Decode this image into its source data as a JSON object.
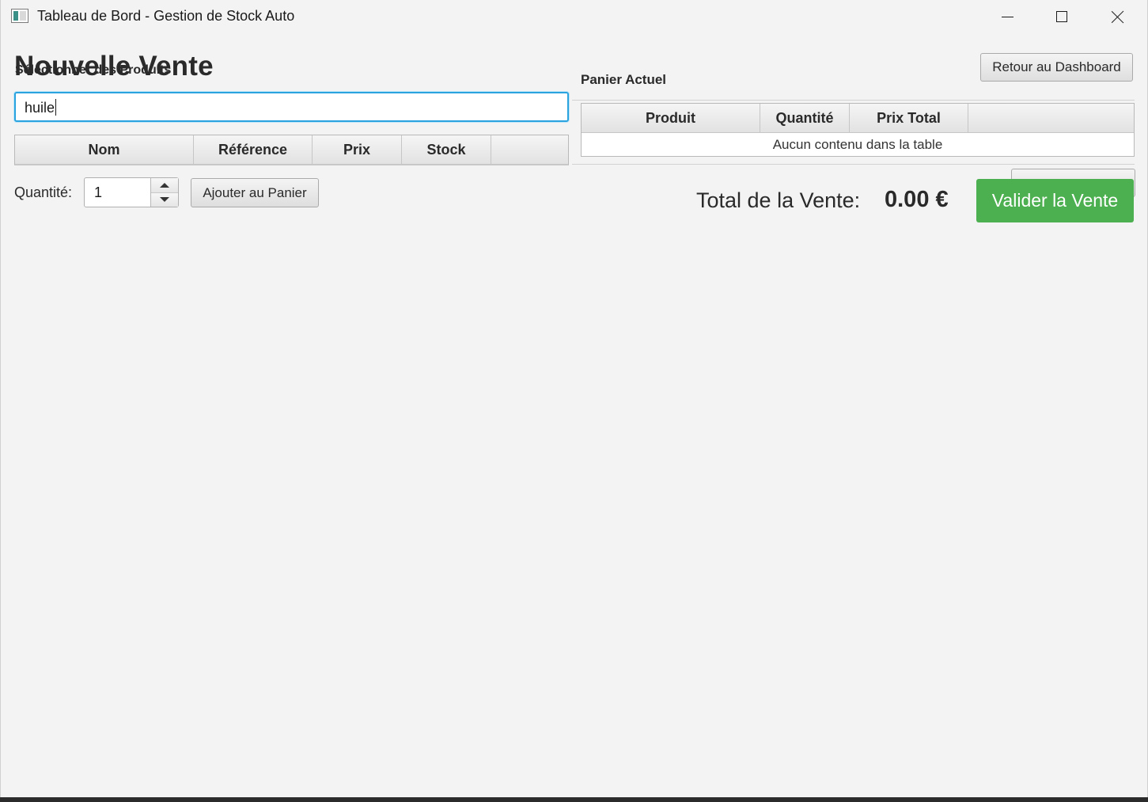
{
  "window": {
    "title": "Tableau de Bord - Gestion de Stock Auto"
  },
  "page": {
    "title": "Nouvelle Vente",
    "back_button": "Retour au Dashboard"
  },
  "products": {
    "section_title": "Sélectionner des Produits",
    "search_value": "huile",
    "columns": [
      "Nom",
      "Référence",
      "Prix",
      "Stock"
    ]
  },
  "quantity": {
    "label": "Quantité:",
    "value": "1"
  },
  "add_button": "Ajouter au Panier",
  "cart": {
    "section_title": "Panier Actuel",
    "columns": [
      "Produit",
      "Quantité",
      "Prix Total"
    ],
    "empty_message": "Aucun contenu dans la table"
  },
  "total": {
    "label": "Total de la Vente:",
    "value": "0.00 €"
  },
  "validate_button": "Valider la Vente",
  "colors": {
    "accent": "#2aa3df",
    "validate": "#4caf50"
  },
  "icons": {
    "app": "app-icon",
    "minimize": "minimize-icon",
    "maximize": "maximize-icon",
    "close": "close-icon",
    "spinner_up": "chevron-up-icon",
    "spinner_down": "chevron-down-icon"
  }
}
